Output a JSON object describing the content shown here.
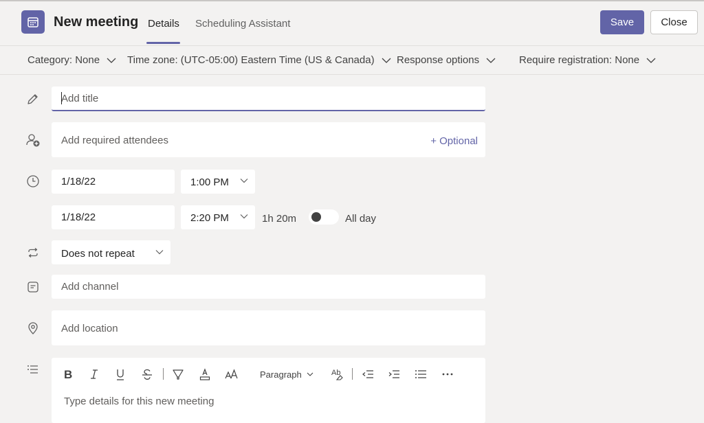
{
  "header": {
    "title": "New meeting",
    "tabs": [
      {
        "label": "Details",
        "active": true
      },
      {
        "label": "Scheduling Assistant",
        "active": false
      }
    ],
    "save_label": "Save",
    "close_label": "Close",
    "accent_color": "#6264a7"
  },
  "options": {
    "category": "Category: None",
    "time_zone": "Time zone: (UTC-05:00) Eastern Time (US & Canada)",
    "response_options": "Response options",
    "registration": "Require registration: None"
  },
  "form": {
    "title_placeholder": "Add title",
    "attendees_placeholder": "Add required attendees",
    "optional_label": "+ Optional",
    "start_date": "1/18/22",
    "start_time": "1:00 PM",
    "end_date": "1/18/22",
    "end_time": "2:20 PM",
    "duration": "1h 20m",
    "all_day_label": "All day",
    "all_day_on": false,
    "repeat": "Does not repeat",
    "channel_placeholder": "Add channel",
    "location_placeholder": "Add location",
    "details_placeholder": "Type details for this new meeting"
  },
  "editor_toolbar": {
    "paragraph_label": "Paragraph",
    "items": [
      "bold-icon",
      "italic-icon",
      "underline-icon",
      "strikethrough-icon",
      "highlight-icon",
      "font-color-icon",
      "font-size-icon",
      "paragraph-dropdown",
      "clear-formatting-icon",
      "decrease-indent-icon",
      "increase-indent-icon",
      "bulleted-list-icon",
      "more-options-icon"
    ]
  }
}
